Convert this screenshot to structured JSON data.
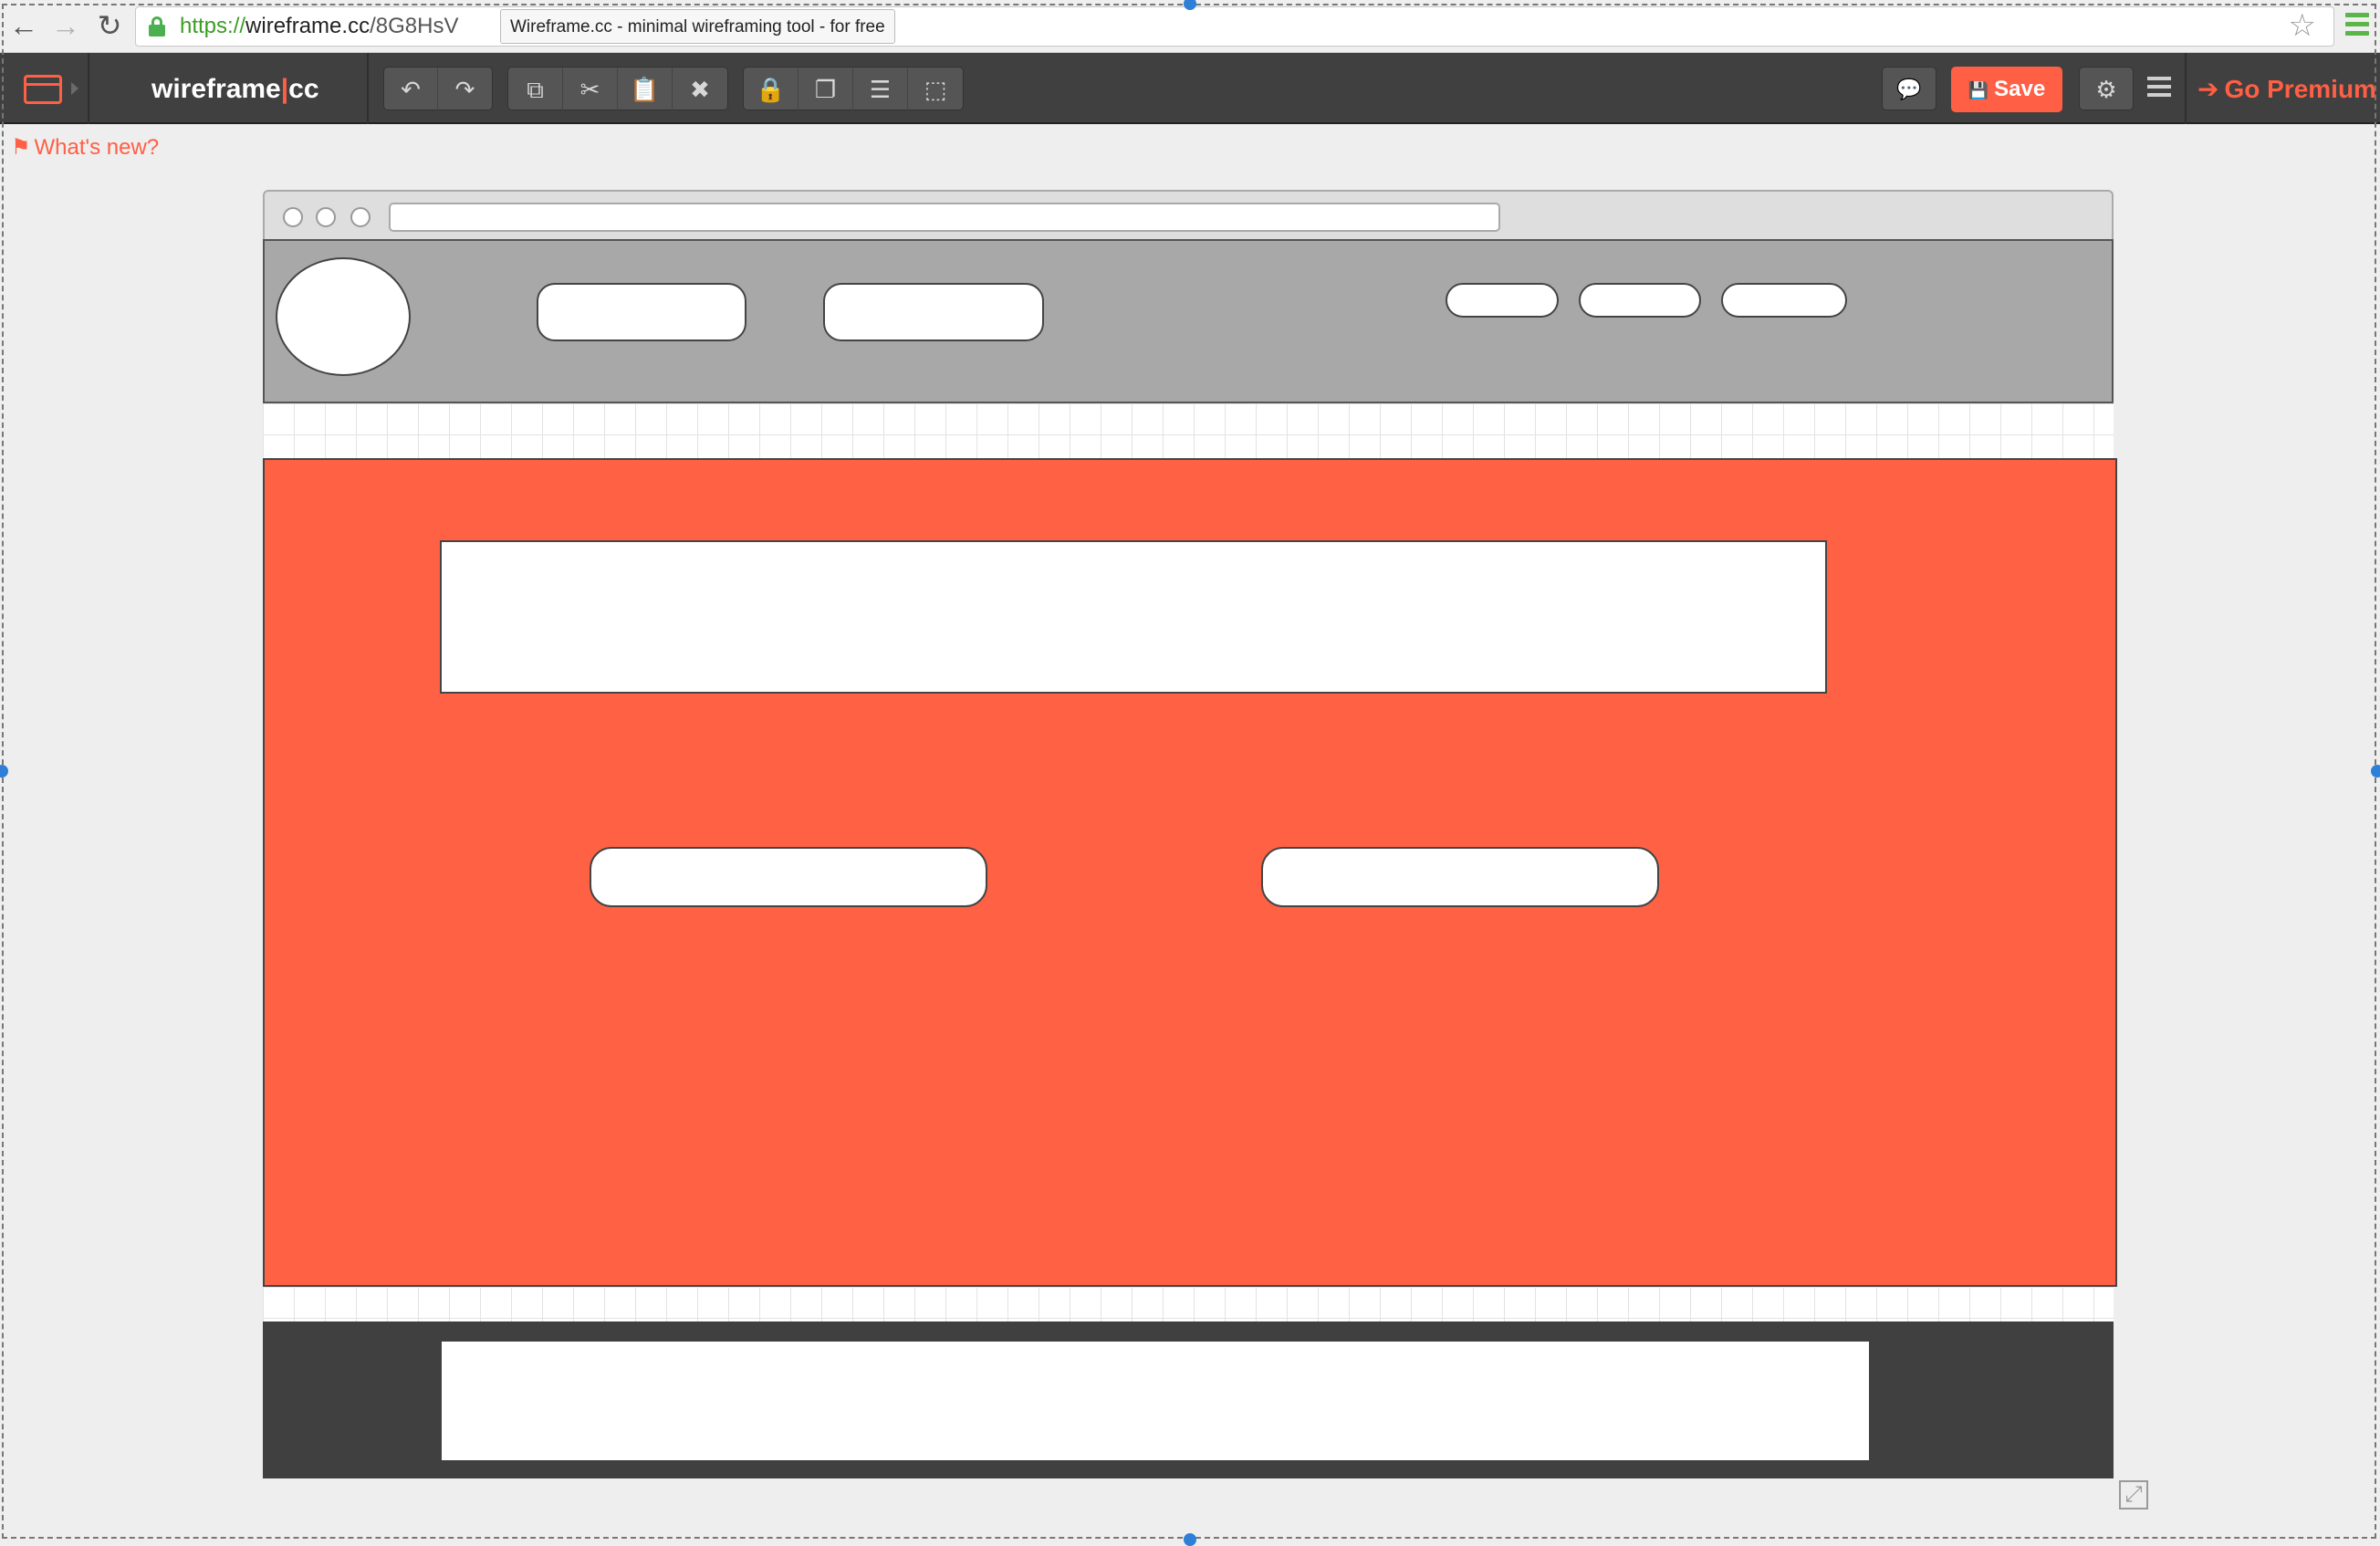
{
  "browser": {
    "url_scheme": "https://",
    "url_host": "wireframe.cc",
    "url_path": "/8G8HsV",
    "tab_tooltip": "Wireframe.cc - minimal wireframing tool - for free",
    "back_icon": "←",
    "forward_icon": "→",
    "reload_icon": "↻",
    "star_icon": "☆"
  },
  "toolbar": {
    "logo_left": "wireframe",
    "logo_sep": "|",
    "logo_right": "cc",
    "undo_icon": "↶",
    "redo_icon": "↷",
    "copy_icon": "⧉",
    "cut_icon": "✂",
    "paste_icon": "📋",
    "delete_icon": "✖",
    "lock_icon": "🔒",
    "arrange_icon": "❐",
    "align_icon": "☰",
    "group_icon": "⬚",
    "comment_icon": "💬",
    "save_icon": "💾",
    "save_label": "Save",
    "settings_icon": "⚙",
    "premium_arrow": "➔",
    "premium_label": "Go Premium"
  },
  "whats_new": {
    "flag_icon": "⚑",
    "label": "What's new?"
  },
  "resize_icon": "⤢",
  "colors": {
    "accent": "#ff5f45",
    "toolbar_bg": "#404040",
    "hero_bg": "#ff6145",
    "header_bg": "#a8a8a8",
    "footer_bg": "#404040"
  }
}
